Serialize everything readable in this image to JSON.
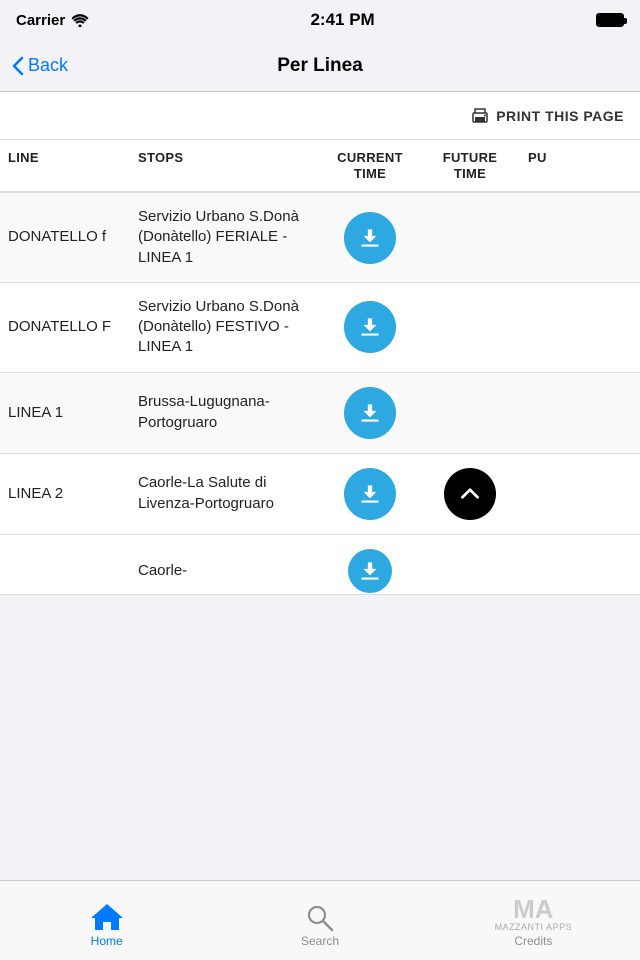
{
  "statusBar": {
    "carrier": "Carrier",
    "wifi": "WiFi",
    "time": "2:41 PM"
  },
  "navBar": {
    "backLabel": "Back",
    "title": "Per Linea"
  },
  "printBar": {
    "printLabel": "PRINT THIS PAGE"
  },
  "tableHeader": {
    "line": "LINE",
    "stops": "STOPS",
    "currentTime": "CURRENT TIME",
    "futureTime": "FUTURE TIME",
    "pu": "PU"
  },
  "rows": [
    {
      "line": "DONATELLO f",
      "stops": "Servizio Urbano S.Donà (Donàtello) FERIALE - LINEA 1",
      "hasDownload": true,
      "hasFutureDownload": false,
      "hasPU": false
    },
    {
      "line": "DONATELLO F",
      "stops": "Servizio Urbano S.Donà (Donàtello) FESTIVO - LINEA 1",
      "hasDownload": true,
      "hasFutureDownload": false,
      "hasPU": false
    },
    {
      "line": "LINEA 1",
      "stops": "Brussa-Lugugnana-Portogruaro",
      "hasDownload": true,
      "hasFutureDownload": false,
      "hasPU": false
    },
    {
      "line": "LINEA 2",
      "stops": "Caorle-La Salute di Livenza-Portogruaro",
      "hasDownload": true,
      "hasFutureDownload": true,
      "hasPU": false
    },
    {
      "line": "",
      "stops": "Caorle-",
      "hasDownload": true,
      "hasFutureDownload": false,
      "hasPU": false,
      "partial": true
    }
  ],
  "tabBar": {
    "home": "Home",
    "search": "Search",
    "credits": "Credits",
    "creditsMA": "MA",
    "creditsSub": "MAZZANTI APPS"
  }
}
